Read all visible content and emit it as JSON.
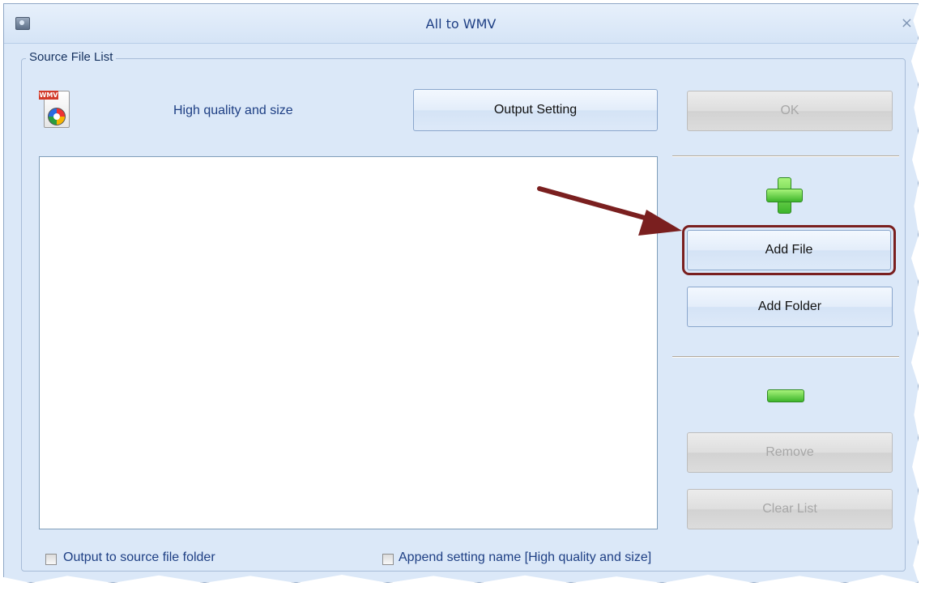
{
  "window": {
    "title": "All to WMV",
    "close_glyph": "×"
  },
  "group": {
    "legend": "Source File List"
  },
  "profile": {
    "icon": "wmv-file-icon",
    "icon_tag": "WMV",
    "quality_label": "High quality and size"
  },
  "buttons": {
    "output_setting": "Output Setting",
    "ok": "OK",
    "add_file": "Add File",
    "add_folder": "Add Folder",
    "remove": "Remove",
    "clear_list": "Clear List"
  },
  "options": {
    "output_to_source": "Output to source file folder",
    "append_setting": "Append setting name [High quality and size]"
  },
  "colors": {
    "annotation_arrow": "#7a1f1f",
    "add_icon": "#3db52b"
  }
}
